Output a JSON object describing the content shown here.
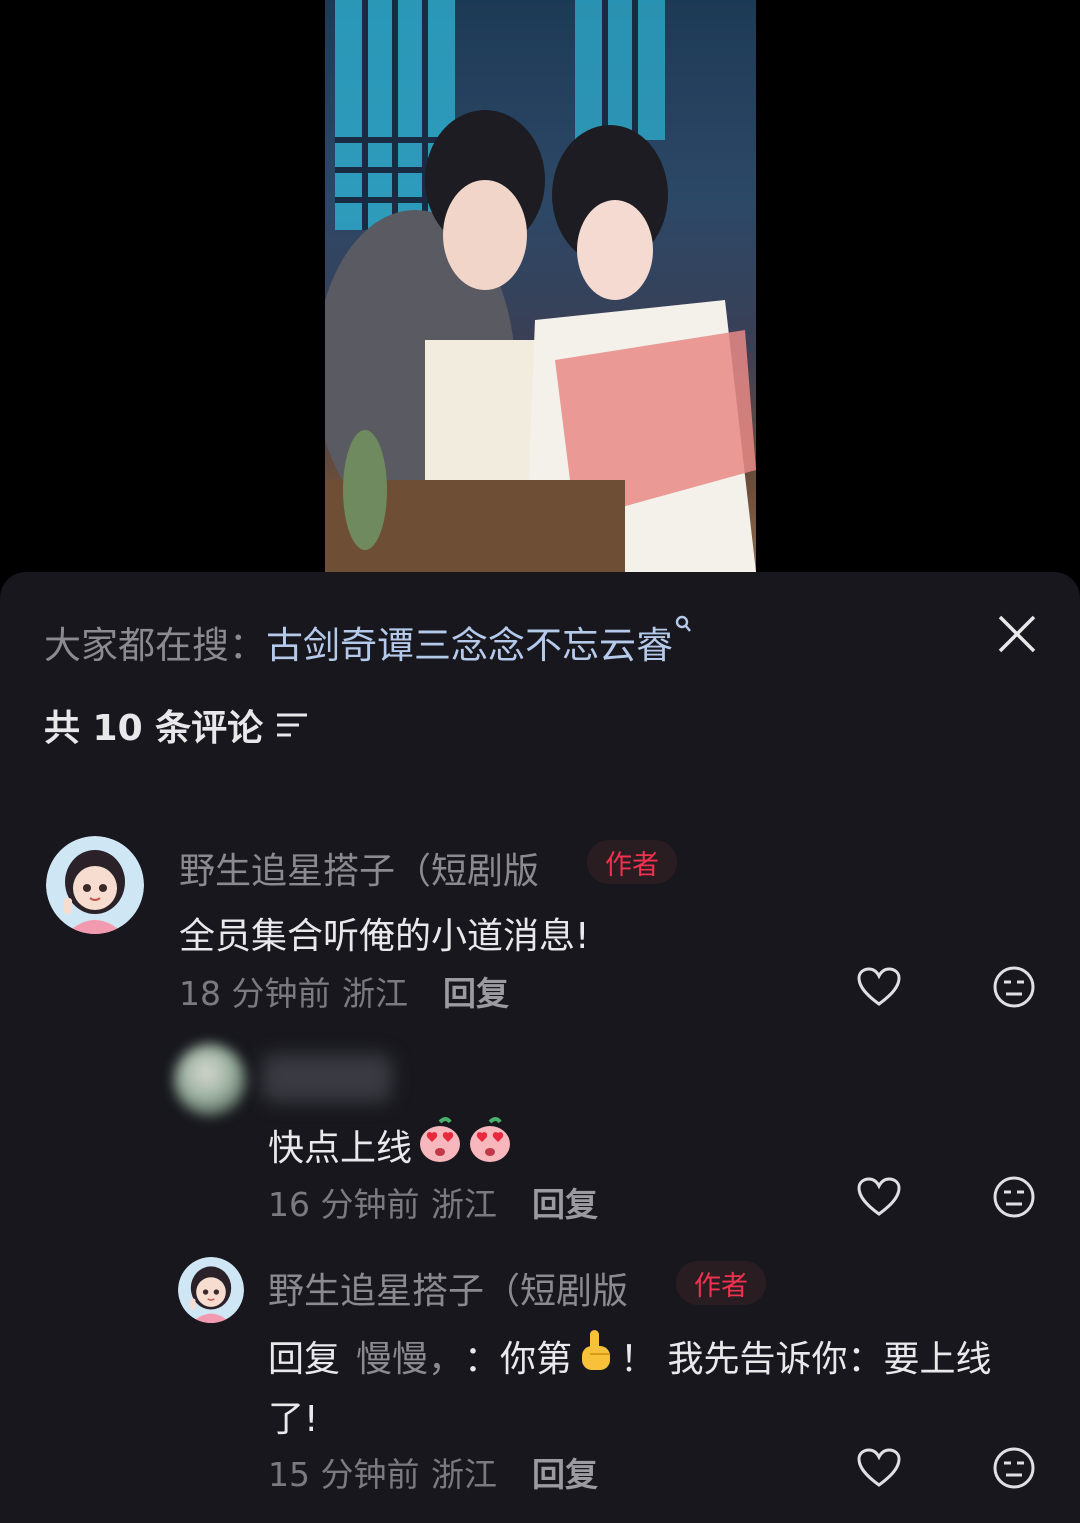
{
  "search": {
    "prefix": "大家都在搜：",
    "term": "古剑奇谭三念念不忘云睿",
    "icon": "search-icon"
  },
  "comments_header": {
    "count_text": "共 10 条评论",
    "sort_icon": "sort-icon"
  },
  "comments": [
    {
      "username": "野生追星搭子（短剧版",
      "badge": "作者",
      "text": "全员集合听俺的小道消息!",
      "time": "18 分钟前",
      "location": "浙江",
      "reply_label": "回复"
    }
  ],
  "replies": [
    {
      "username": "",
      "text": "快点上线",
      "time": "16 分钟前",
      "location": "浙江",
      "reply_label": "回复"
    },
    {
      "username": "野生追星搭子（短剧版",
      "badge": "作者",
      "reply_prefix": "回复",
      "reply_to": "慢慢，",
      "text_part1": "：你第",
      "text_part2": "！ 我先告诉你：要上线",
      "text_line2": "了!",
      "time": "15 分钟前",
      "location": "浙江",
      "reply_label": "回复"
    }
  ],
  "colors": {
    "sheet_bg": "#17171d",
    "search_term": "#b5c9ea",
    "badge_text": "#f0314f"
  }
}
